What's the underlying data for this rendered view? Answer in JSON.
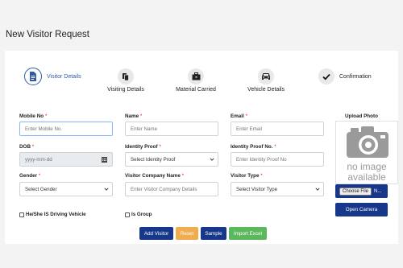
{
  "page": {
    "title": "New Visitor Request"
  },
  "stepper": [
    {
      "label": "Visitor Details",
      "icon": "document-icon",
      "active": true
    },
    {
      "label": "Visiting Details",
      "icon": "files-icon",
      "active": false
    },
    {
      "label": "Material Carried",
      "icon": "briefcase-icon",
      "active": false
    },
    {
      "label": "Vehicle Details",
      "icon": "car-icon",
      "active": false
    },
    {
      "label": "Confirmation",
      "icon": "check-icon",
      "active": false
    }
  ],
  "form": {
    "mobile": {
      "label": "Mobile No",
      "placeholder": "Enter Mobile No."
    },
    "name": {
      "label": "Name",
      "placeholder": "Enter Name"
    },
    "email": {
      "label": "Email",
      "placeholder": "Enter Email"
    },
    "dob": {
      "label": "DOB",
      "placeholder": "yyyy-mm-dd"
    },
    "identity_proof": {
      "label": "Identity Proof",
      "value": "Select Identity Proof"
    },
    "identity_proof_no": {
      "label": "Identity Proof No.",
      "placeholder": "Enter Identity Proof No"
    },
    "gender": {
      "label": "Gender",
      "value": "Select Gender"
    },
    "company": {
      "label": "Visitor Company Name",
      "placeholder": "Enter Visitor Company Details"
    },
    "visitor_type": {
      "label": "Visitor Type",
      "value": "Select Visitor Type"
    },
    "driving_vehicle": {
      "label": "He/She IS Driving Vehicle"
    },
    "is_group": {
      "label": "Is Group"
    },
    "required_mark": "*"
  },
  "photo": {
    "label": "Upload Photo",
    "placeholder_line1": "no image",
    "placeholder_line2": "available",
    "choose_file": "Choose File",
    "file_status": "N...",
    "open_camera": "Open Camera"
  },
  "actions": {
    "add_visitor": "Add Visitor",
    "reset": "Reset",
    "sample": "Sample",
    "import_excel": "Import Excel"
  },
  "colors": {
    "primary": "#17378a",
    "accent": "#2f5aa8",
    "reset": "#f0ad4e",
    "import": "#5cb85c",
    "required": "#dd2222"
  }
}
